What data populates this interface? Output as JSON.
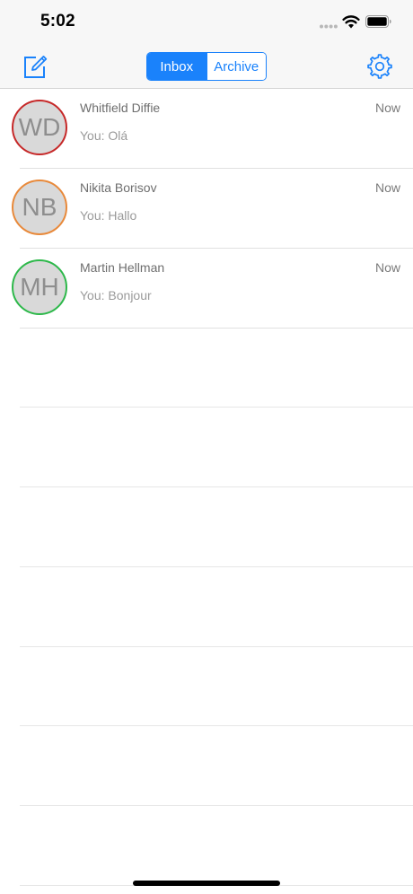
{
  "status_bar": {
    "time": "5:02"
  },
  "nav": {
    "compose_icon": "compose-icon",
    "settings_icon": "gear-icon",
    "segments": [
      {
        "label": "Inbox",
        "active": true
      },
      {
        "label": "Archive",
        "active": false
      }
    ]
  },
  "conversations": [
    {
      "initials": "WD",
      "name": "Whitfield Diffie",
      "preview": "You: Olá",
      "time": "Now",
      "ring_color": "#c62828"
    },
    {
      "initials": "NB",
      "name": "Nikita Borisov",
      "preview": "You: Hallo",
      "time": "Now",
      "ring_color": "#e8893a"
    },
    {
      "initials": "MH",
      "name": "Martin Hellman",
      "preview": "You: Bonjour",
      "time": "Now",
      "ring_color": "#2db84a"
    }
  ],
  "colors": {
    "accent": "#1a82fb",
    "bar_background": "#f7f7f7"
  }
}
